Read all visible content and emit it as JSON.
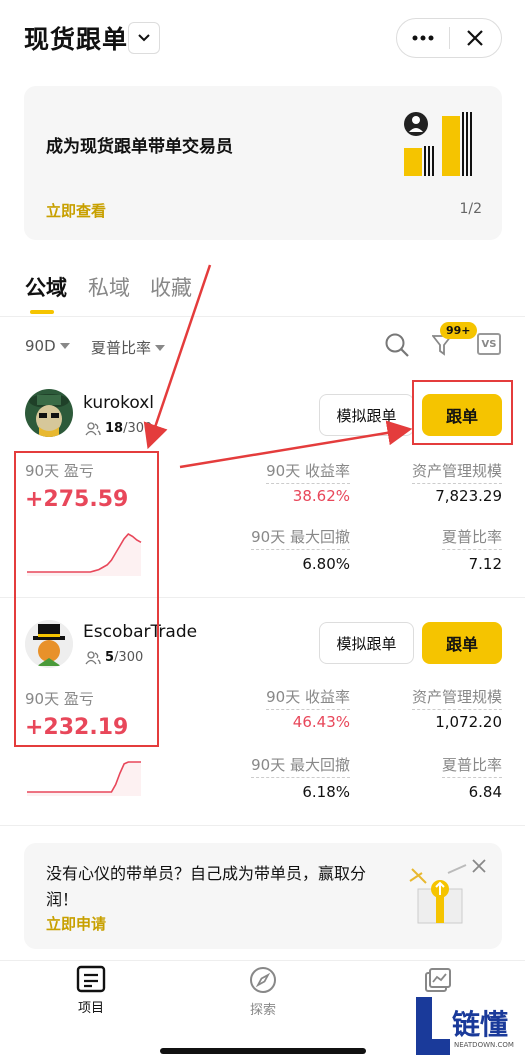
{
  "header": {
    "title": "现货跟单"
  },
  "banner": {
    "title": "成为现货跟单带单交易员",
    "link": "立即查看",
    "page": "1/2"
  },
  "tabs": [
    {
      "label": "公域",
      "active": true
    },
    {
      "label": "私域",
      "active": false
    },
    {
      "label": "收藏",
      "active": false
    }
  ],
  "filters": {
    "period": "90D",
    "sort": "夏普比率",
    "badge": "99+",
    "vs": "VS"
  },
  "traders": [
    {
      "name": "kurokoxl",
      "followers": "18",
      "capacity": "/300",
      "sim_label": "模拟跟单",
      "follow_label": "跟单",
      "pnl_label": "90天 盈亏",
      "pnl": "+275.59",
      "roi_label": "90天 收益率",
      "roi": "38.62%",
      "aum_label": "资产管理规模",
      "aum": "7,823.29",
      "mdd_label": "90天 最大回撤",
      "mdd": "6.80%",
      "sharpe_label": "夏普比率",
      "sharpe": "7.12",
      "spark": [
        0,
        0,
        0,
        0,
        0,
        0,
        0,
        0,
        0,
        0,
        0,
        0,
        0,
        0,
        0,
        0,
        1,
        2,
        4,
        6,
        10,
        16,
        22,
        28,
        32,
        30,
        27,
        25
      ]
    },
    {
      "name": "EscobarTrade",
      "followers": "5",
      "capacity": "/300",
      "sim_label": "模拟跟单",
      "follow_label": "跟单",
      "pnl_label": "90天 盈亏",
      "pnl": "+232.19",
      "roi_label": "90天 收益率",
      "roi": "46.43%",
      "aum_label": "资产管理规模",
      "aum": "1,072.20",
      "mdd_label": "90天 最大回撤",
      "mdd": "6.18%",
      "sharpe_label": "夏普比率",
      "sharpe": "6.84",
      "spark": [
        0,
        0,
        0,
        0,
        0,
        0,
        0,
        0,
        0,
        0,
        0,
        0,
        0,
        0,
        0,
        0,
        0,
        0,
        0,
        0,
        0,
        8,
        20,
        30,
        32,
        32,
        32,
        32
      ]
    }
  ],
  "recruit": {
    "text": "没有心仪的带单员？自己成为带单员，赢取分润！",
    "link": "立即申请"
  },
  "nav": [
    {
      "label": "项目",
      "icon": "list-icon"
    },
    {
      "label": "探索",
      "icon": "compass-icon"
    },
    {
      "label": "",
      "icon": "chart-icon"
    }
  ],
  "watermark": {
    "text": "链懂",
    "sub": "NEATDOWN.COM"
  },
  "colors": {
    "accent": "#f5c400",
    "profit": "#e8475a",
    "annotation": "#e43c3c"
  }
}
